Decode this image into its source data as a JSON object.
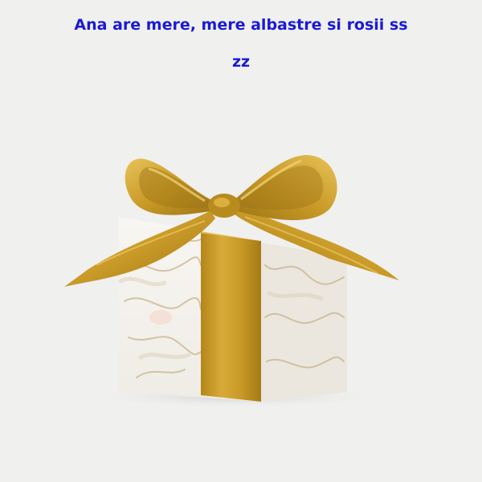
{
  "caption": {
    "line1": "Ana are mere, mere albastre si rosii ss",
    "line2": "zz"
  },
  "image": {
    "subject": "gift-box-icon",
    "colors": {
      "background": "#f0f0ef",
      "ribbon": "#c99a27",
      "ribbon_highlight": "#e3b94a",
      "ribbon_shadow": "#9c7416",
      "box": "#f7f5f1",
      "marble_vein": "#c8b48a",
      "text": "#1a1ad6"
    }
  }
}
